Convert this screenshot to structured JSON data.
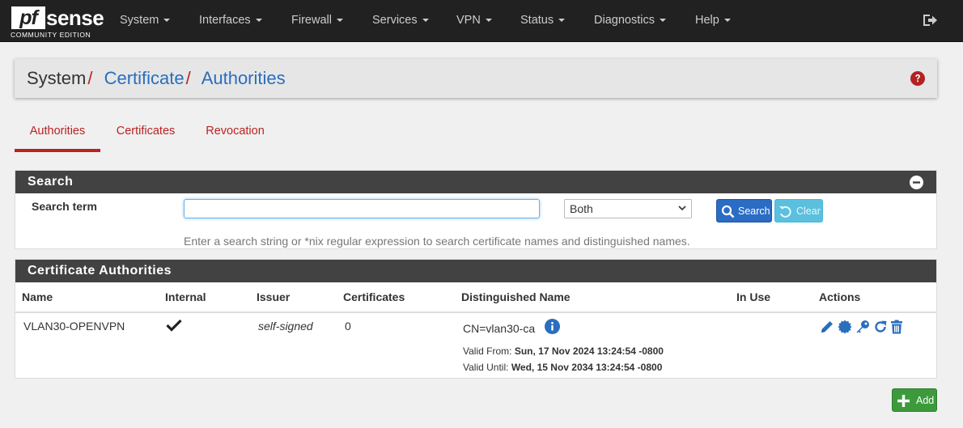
{
  "brand": {
    "logo_pf": "pf",
    "logo_sense": "sense",
    "edition": "COMMUNITY EDITION"
  },
  "nav": {
    "items": [
      {
        "label": "System"
      },
      {
        "label": "Interfaces"
      },
      {
        "label": "Firewall"
      },
      {
        "label": "Services"
      },
      {
        "label": "VPN"
      },
      {
        "label": "Status"
      },
      {
        "label": "Diagnostics"
      },
      {
        "label": "Help"
      }
    ],
    "logout_icon": "sign-out-icon"
  },
  "breadcrumb": {
    "root": "System",
    "sep1": "/",
    "level2": "Certificate",
    "sep2": "/",
    "level3": "Authorities",
    "help_icon": "question-circle-icon"
  },
  "tabs": [
    {
      "label": "Authorities",
      "active": true
    },
    {
      "label": "Certificates",
      "active": false
    },
    {
      "label": "Revocation",
      "active": false
    }
  ],
  "search_panel": {
    "title": "Search",
    "term_label": "Search term",
    "term_value": "",
    "scope_selected": "Both",
    "search_button": "Search",
    "clear_button": "Clear",
    "help": "Enter a search string or *nix regular expression to search certificate names and distinguished names."
  },
  "ca_panel": {
    "title": "Certificate Authorities",
    "columns": [
      "Name",
      "Internal",
      "Issuer",
      "Certificates",
      "Distinguished Name",
      "In Use",
      "Actions"
    ],
    "rows": [
      {
        "name": "VLAN30-OPENVPN",
        "internal": "check-icon",
        "issuer": "self-signed",
        "certificates": "0",
        "dn": "CN=vlan30-ca",
        "valid_from_label": "Valid From:",
        "valid_from": "Sun, 17 Nov 2024 13:24:54 -0800",
        "valid_until_label": "Valid Until:",
        "valid_until": "Wed, 15 Nov 2034 13:24:54 -0800",
        "in_use": "",
        "actions": [
          "edit-pencil-icon",
          "certificate-badge-icon",
          "export-key-icon",
          "renew-refresh-icon",
          "delete-trash-icon"
        ]
      }
    ]
  },
  "add_button": "Add",
  "colors": {
    "accent_red": "#b22222",
    "link_blue": "#2a6ebd",
    "navbar": "#212121",
    "panel_head": "#424242",
    "success": "#3c9a3c"
  }
}
